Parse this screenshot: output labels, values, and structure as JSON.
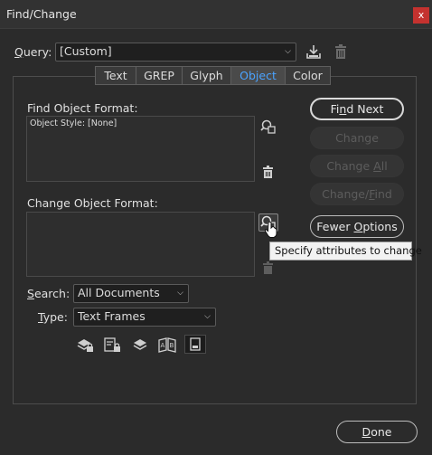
{
  "window": {
    "title": "Find/Change",
    "close_glyph": "x"
  },
  "query": {
    "label_prefix": "Q",
    "label_rest": "uery:",
    "value": "[Custom]",
    "save_icon": "save-query-icon",
    "delete_icon": "delete-query-icon"
  },
  "tabs": [
    {
      "label": "Text"
    },
    {
      "label": "GREP"
    },
    {
      "label": "Glyph"
    },
    {
      "label": "Object"
    },
    {
      "label": "Color"
    }
  ],
  "active_tab": "Object",
  "find_format": {
    "label": "Find Object Format:",
    "value": "Object Style: [None]"
  },
  "change_format": {
    "label": "Change Object Format:",
    "value": ""
  },
  "buttons": {
    "find_next_pre": "Fi",
    "find_next_key": "n",
    "find_next_post": "d Next",
    "change": "Change",
    "change_all_pre": "Change ",
    "change_all_key": "A",
    "change_all_post": "ll",
    "change_find_pre": "Change/",
    "change_find_key": "F",
    "change_find_post": "ind",
    "fewer_pre": "Fewer ",
    "fewer_key": "O",
    "fewer_post": "ptions",
    "done_key": "D",
    "done_post": "one"
  },
  "tooltip": "Specify attributes to change",
  "search": {
    "label_key": "S",
    "label_rest": "earch:",
    "value": "All Documents"
  },
  "type": {
    "label_key": "T",
    "label_rest": "ype:",
    "value": "Text Frames"
  },
  "colors": {
    "accent": "#4aa3ff",
    "close": "#c4322f",
    "background": "#2b2b2b"
  }
}
